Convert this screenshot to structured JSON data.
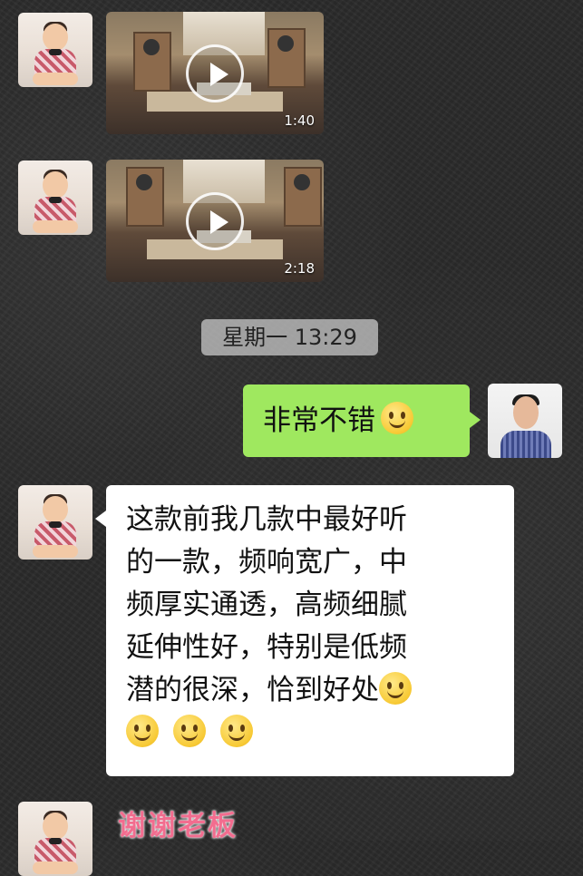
{
  "messages": [
    {
      "type": "video",
      "duration": "1:40"
    },
    {
      "type": "video",
      "duration": "2:18"
    },
    {
      "type": "timestamp",
      "text": "星期一 13:29"
    },
    {
      "type": "text-out",
      "text": "非常不错",
      "emoji": "smiley"
    },
    {
      "type": "text-in",
      "lines": [
        "这款前我几款中最好听",
        "的一款，频响宽广，中",
        "频厚实通透，高频细腻",
        "延伸性好，特别是低频",
        "潜的很深，恰到好处"
      ],
      "emoji_count": 4
    },
    {
      "type": "caption",
      "text": "谢谢老板"
    }
  ],
  "icons": {
    "play": "play-icon",
    "emoji": "smiley-emoji-icon"
  },
  "colors": {
    "outgoing_bubble": "#9fe85f",
    "incoming_bubble": "#ffffff",
    "caption": "#f26d8f",
    "background": "#2a2a2a"
  }
}
